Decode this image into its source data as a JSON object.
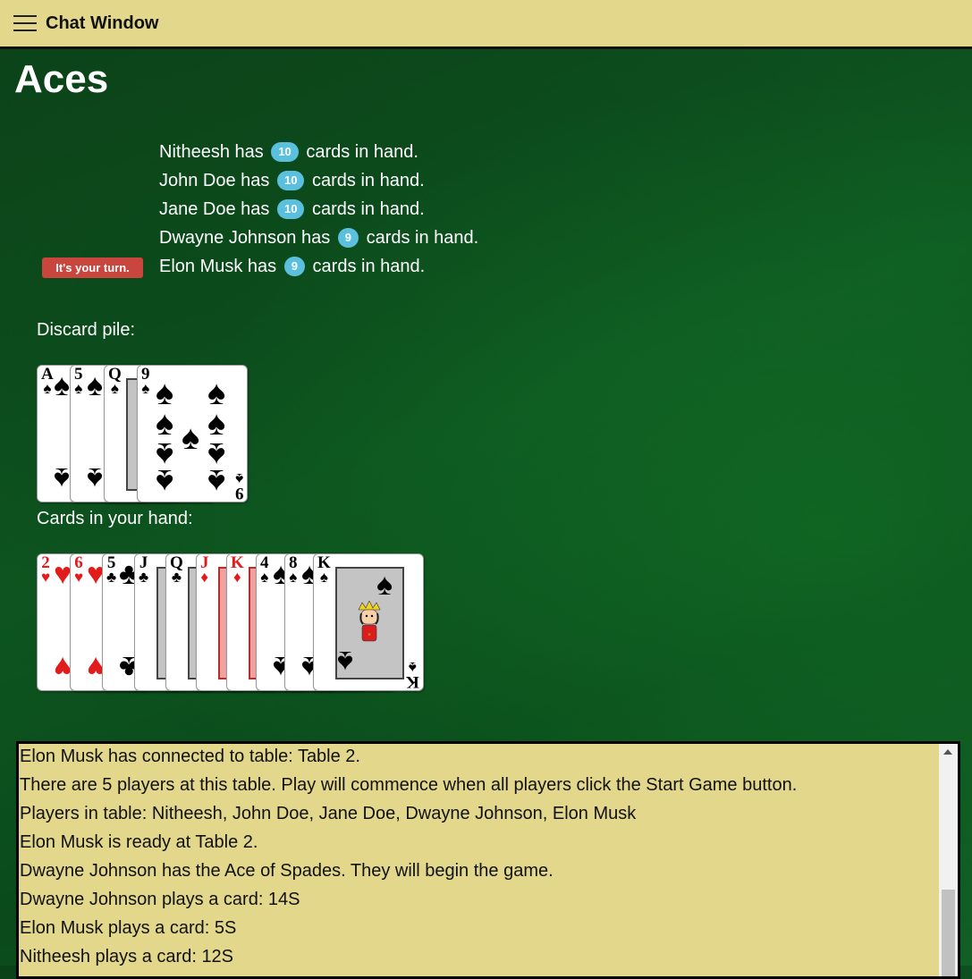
{
  "header": {
    "chat_label": "Chat Window",
    "menu_icon": "hamburger-menu-icon",
    "background": "#e2d78b"
  },
  "game": {
    "title": "Aces",
    "players": [
      {
        "name": "Nitheesh",
        "pre": "Nitheesh has",
        "count": "10",
        "post": "cards in hand."
      },
      {
        "name": "John Doe",
        "pre": "John Doe has",
        "count": "10",
        "post": "cards in hand."
      },
      {
        "name": "Jane Doe",
        "pre": "Jane Doe has",
        "count": "10",
        "post": "cards in hand."
      },
      {
        "name": "Dwayne Johnson",
        "pre": "Dwayne Johnson has",
        "count": "9",
        "post": "cards in hand."
      },
      {
        "name": "Elon Musk",
        "pre": "Elon Musk has",
        "count": "9",
        "post": "cards in hand."
      }
    ],
    "turn_badge": "It's your turn.",
    "discard_label": "Discard pile:",
    "hand_label": "Cards in your hand:",
    "discard_pile": [
      {
        "rank": "A",
        "suit": "♠",
        "color": "black"
      },
      {
        "rank": "5",
        "suit": "♠",
        "color": "black"
      },
      {
        "rank": "Q",
        "suit": "♠",
        "color": "black"
      },
      {
        "rank": "9",
        "suit": "♠",
        "color": "black"
      }
    ],
    "hand": [
      {
        "rank": "2",
        "suit": "♥",
        "color": "red"
      },
      {
        "rank": "6",
        "suit": "♥",
        "color": "red"
      },
      {
        "rank": "5",
        "suit": "♣",
        "color": "black"
      },
      {
        "rank": "J",
        "suit": "♣",
        "color": "black"
      },
      {
        "rank": "Q",
        "suit": "♣",
        "color": "black"
      },
      {
        "rank": "J",
        "suit": "♦",
        "color": "red"
      },
      {
        "rank": "K",
        "suit": "♦",
        "color": "red"
      },
      {
        "rank": "4",
        "suit": "♠",
        "color": "black"
      },
      {
        "rank": "8",
        "suit": "♠",
        "color": "black"
      },
      {
        "rank": "K",
        "suit": "♠",
        "color": "black"
      }
    ]
  },
  "chat_log": [
    "Elon Musk has connected to table: Table 2.",
    "There are 5 players at this table. Play will commence when all players click the Start Game button.",
    "Players in table: Nitheesh, John Doe, Jane Doe, Dwayne Johnson, Elon Musk",
    "Elon Musk is ready at Table 2.",
    "Dwayne Johnson has the Ace of Spades. They will begin the game.",
    "Dwayne Johnson plays a card: 14S",
    "Elon Musk plays a card: 5S",
    "Nitheesh plays a card: 12S"
  ],
  "colors": {
    "table_green": "#0e5a22",
    "badge_blue": "#5bc0de",
    "turn_red": "#c9463e",
    "chat_bg": "#e2d78b"
  }
}
